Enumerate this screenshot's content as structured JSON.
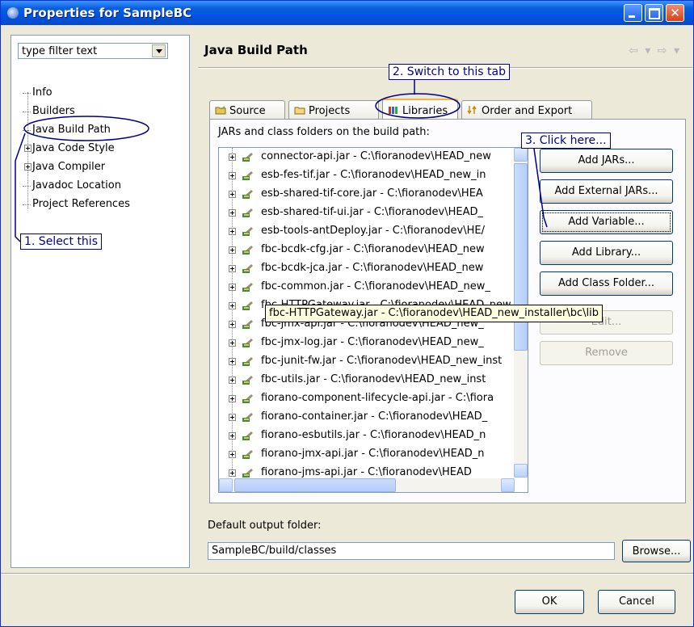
{
  "window": {
    "title": "Properties for SampleBC"
  },
  "filter": {
    "text": "type filter text"
  },
  "tree": {
    "items": [
      {
        "label": "Info",
        "expandable": false
      },
      {
        "label": "Builders",
        "expandable": false
      },
      {
        "label": "Java Build Path",
        "expandable": false,
        "selected": true
      },
      {
        "label": "Java Code Style",
        "expandable": true
      },
      {
        "label": "Java Compiler",
        "expandable": true
      },
      {
        "label": "Javadoc Location",
        "expandable": false
      },
      {
        "label": "Project References",
        "expandable": false
      }
    ]
  },
  "page": {
    "heading": "Java Build Path",
    "nav_arrows": "⇦ ▾ ⇨ ▾"
  },
  "tabs": [
    {
      "label": "Source",
      "icon": "source-folder-icon"
    },
    {
      "label": "Projects",
      "icon": "projects-icon"
    },
    {
      "label": "Libraries",
      "icon": "libraries-icon",
      "active": true
    },
    {
      "label": "Order and Export",
      "icon": "order-export-icon"
    }
  ],
  "libraries": {
    "label": "JARs and class folders on the build path:",
    "jars": [
      "connector-api.jar - C:\\fioranodev\\HEAD_new",
      "esb-fes-tif.jar - C:\\fioranodev\\HEAD_new_in",
      "esb-shared-tif-core.jar - C:\\fioranodev\\HEA",
      "esb-shared-tif-ui.jar - C:\\fioranodev\\HEAD_",
      "esb-tools-antDeploy.jar - C:\\fioranodev\\HE/",
      "fbc-bcdk-cfg.jar - C:\\fioranodev\\HEAD_new",
      "fbc-bcdk-jca.jar - C:\\fioranodev\\HEAD_new",
      "fbc-common.jar - C:\\fioranodev\\HEAD_new_",
      "fbc-HTTPGateway.jar - C:\\fioranodev\\HEAD_new_installer\\bc\\lib",
      "fbc-jmx-api.jar - C:\\fioranodev\\HEAD_new_",
      "fbc-jmx-log.jar - C:\\fioranodev\\HEAD_new_",
      "fbc-junit-fw.jar - C:\\fioranodev\\HEAD_new_inst",
      "fbc-utils.jar - C:\\fioranodev\\HEAD_new_inst",
      "fiorano-component-lifecycle-api.jar - C:\\fiora",
      "fiorano-container.jar - C:\\fioranodev\\HEAD_",
      "fiorano-esbutils.jar - C:\\fioranodev\\HEAD_n",
      "fiorano-jmx-api.jar - C:\\fioranodev\\HEAD_n",
      "fiorano-jms-api.jar - C:\\fioranodev\\HEAD"
    ],
    "tooltip": "fbc-HTTPGateway.jar - C:\\fioranodev\\HEAD_new_installer\\bc\\lib"
  },
  "buttons": {
    "add_jars": "Add JARs...",
    "add_external_jars": "Add External JARs...",
    "add_variable": "Add Variable...",
    "add_library": "Add Library...",
    "add_class_folder": "Add Class Folder...",
    "edit": "Edit...",
    "remove": "Remove"
  },
  "output": {
    "label": "Default output folder:",
    "value": "SampleBC/build/classes",
    "browse": "Browse..."
  },
  "dialog": {
    "ok": "OK",
    "cancel": "Cancel"
  },
  "annotations": {
    "step1": "1. Select this",
    "step2": "2. Switch to this tab",
    "step3": "3. Click here...",
    "color": "#00008b"
  }
}
